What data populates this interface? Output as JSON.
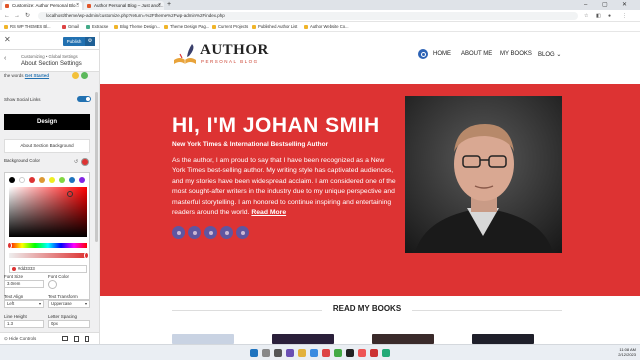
{
  "browser": {
    "tabs": [
      {
        "label": "Customize: Author Personal Blo...",
        "active": true
      },
      {
        "label": "Author Personal Blog – Just anot...",
        "active": false
      }
    ],
    "url": "localhost/theme/wp-admin/customize.php?return=%2Ftheme%2Fwp-admin%2Findex.php",
    "bookmarks": [
      "RS WP THEMES Bl...",
      "Gmail",
      "Extracse",
      "Blog Theme Design...",
      "Theme Design Pag...",
      "Current Projects",
      "Published Author List",
      "Author Website Co..."
    ]
  },
  "customizer": {
    "publish_label": "Publish",
    "breadcrumb": "Customizing • Global Settings",
    "section_title": "About Section Settings",
    "obscured_text": "Get Started",
    "obscured_prefix": "the words",
    "show_social_links_label": "Show Social Links",
    "design_button": "Design",
    "section_background_label": "About Section Background",
    "background_color_label": "Background Color",
    "hex_value": "#dd3333",
    "font_size_label": "Font Size",
    "font_size_value": "3.0rem",
    "font_color_label": "Font Color",
    "text_align_label": "Text Align",
    "text_align_value": "Left",
    "text_transform_label": "Text Transform",
    "text_transform_value": "Uppercase",
    "line_height_label": "Line Height",
    "line_height_value": "1.3",
    "letter_spacing_label": "Letter Spacing",
    "letter_spacing_value": "0px",
    "hide_controls_label": "Hide Controls",
    "swatches": [
      "#000000",
      "#ffffff",
      "#dd3333",
      "#dd9933",
      "#eeee22",
      "#81d742",
      "#1e73be",
      "#8224e3"
    ]
  },
  "site": {
    "logo_title": "AUTHOR",
    "logo_subtitle": "PERSONAL BLOG",
    "menu": [
      "HOME",
      "ABOUT ME",
      "MY BOOKS",
      "BLOG"
    ],
    "hero": {
      "title": "HI, I'M JOHAN SMIH",
      "subtitle": "New York Times & International Bestselling Author",
      "body": "As the author, I am proud to say that I have been recognized as a New York Times best-selling author. My writing style has captivated audiences, and my stories have been widespread acclaim. I am considered one of the most sought-after writers in the industry due to my unique perspective and masterful storytelling. I am honored to continue inspiring and entertaining readers around the world.",
      "read_more": "Read More",
      "background_color": "#dd3333"
    },
    "books_heading": "READ MY BOOKS"
  },
  "taskbar": {
    "time": "11:08 AM",
    "date": "2/12/2023"
  }
}
